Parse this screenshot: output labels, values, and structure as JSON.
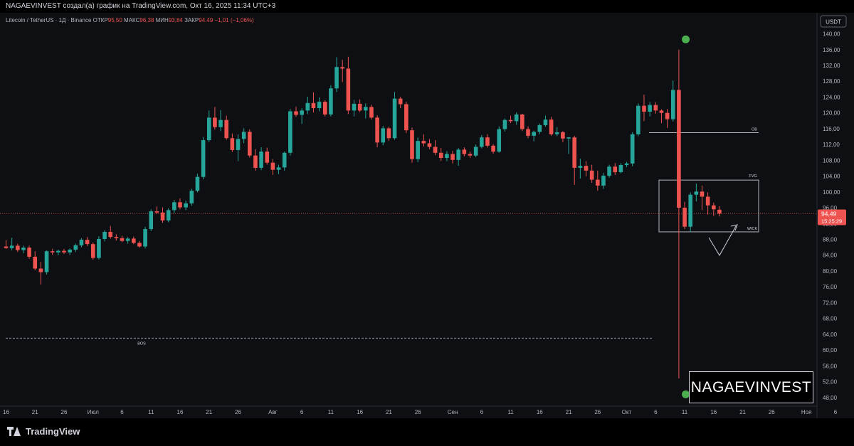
{
  "header": {
    "text": "NAGAEVINVEST создал(а) график на TradingView.com, Окт 16, 2025 11:34 UTC+3"
  },
  "brand": {
    "name": "TradingView"
  },
  "watermark": {
    "text": "NAGAEVINVEST"
  },
  "colors": {
    "up": "#26a69a",
    "down": "#ef5350",
    "background": "#0e0f13",
    "text": "#b2b5be",
    "accent_green": "#4caf50"
  },
  "chart_data": {
    "type": "candlestick",
    "legend": {
      "symbol": "Litecoin / TetherUS · 1Д · Binance",
      "open_label": "ОТКР",
      "open": "95,50",
      "high_label": "МАКС",
      "high": "96,38",
      "low_label": "МИН",
      "low": "93,84",
      "close_label": "ЗАКР",
      "close": "94.49",
      "change": "−1,01 (−1,06%)"
    },
    "currency": "USDT",
    "ylim": [
      45.8,
      142.8
    ],
    "y_ticks": [
      "48,00",
      "52,00",
      "56,00",
      "60,00",
      "64,00",
      "68,00",
      "72,00",
      "76,00",
      "80,00",
      "84,00",
      "88,00",
      "92,00",
      "96,00",
      "100,00",
      "104,00",
      "108,00",
      "112,00",
      "116,00",
      "120,00",
      "124,00",
      "128,00",
      "132,00",
      "136,00",
      "140,00"
    ],
    "y_tick_values": [
      48,
      52,
      56,
      60,
      64,
      68,
      72,
      76,
      80,
      84,
      88,
      92,
      96,
      100,
      104,
      108,
      112,
      116,
      120,
      124,
      128,
      132,
      136,
      140
    ],
    "x_ticks": [
      {
        "label": "16",
        "day": 0
      },
      {
        "label": "21",
        "day": 5
      },
      {
        "label": "26",
        "day": 10
      },
      {
        "label": "Июл",
        "day": 15
      },
      {
        "label": "6",
        "day": 20
      },
      {
        "label": "11",
        "day": 25
      },
      {
        "label": "16",
        "day": 30
      },
      {
        "label": "21",
        "day": 35
      },
      {
        "label": "26",
        "day": 40
      },
      {
        "label": "Авг",
        "day": 46
      },
      {
        "label": "6",
        "day": 51
      },
      {
        "label": "11",
        "day": 56
      },
      {
        "label": "16",
        "day": 61
      },
      {
        "label": "21",
        "day": 66
      },
      {
        "label": "26",
        "day": 71
      },
      {
        "label": "Сен",
        "day": 77
      },
      {
        "label": "6",
        "day": 82
      },
      {
        "label": "11",
        "day": 87
      },
      {
        "label": "16",
        "day": 92
      },
      {
        "label": "21",
        "day": 97
      },
      {
        "label": "26",
        "day": 102
      },
      {
        "label": "Окт",
        "day": 107
      },
      {
        "label": "6",
        "day": 112
      },
      {
        "label": "11",
        "day": 117
      },
      {
        "label": "16",
        "day": 122
      },
      {
        "label": "21",
        "day": 127
      },
      {
        "label": "26",
        "day": 132
      },
      {
        "label": "Ноя",
        "day": 138
      },
      {
        "label": "6",
        "day": 143
      }
    ],
    "candles": [
      [
        86.2,
        87.8,
        85.6,
        85.8
      ],
      [
        85.8,
        88.4,
        85.2,
        86.4
      ],
      [
        86.4,
        86.9,
        84.8,
        85.3
      ],
      [
        85.3,
        86.4,
        84.5,
        85.9
      ],
      [
        85.9,
        86.4,
        83.1,
        83.6
      ],
      [
        83.6,
        85.0,
        80.2,
        80.6
      ],
      [
        80.6,
        82.3,
        76.6,
        79.7
      ],
      [
        79.7,
        85.2,
        79.1,
        85.0
      ],
      [
        85.0,
        85.6,
        84.1,
        84.7
      ],
      [
        84.7,
        85.4,
        84.0,
        85.1
      ],
      [
        85.1,
        85.6,
        84.3,
        84.7
      ],
      [
        84.7,
        85.7,
        84.1,
        85.4
      ],
      [
        85.4,
        86.9,
        84.8,
        86.5
      ],
      [
        86.5,
        88.3,
        86.0,
        87.9
      ],
      [
        87.9,
        88.6,
        86.3,
        86.8
      ],
      [
        86.8,
        87.2,
        82.8,
        83.3
      ],
      [
        83.3,
        88.8,
        82.9,
        88.1
      ],
      [
        88.1,
        90.3,
        87.5,
        89.9
      ],
      [
        89.9,
        91.4,
        88.2,
        88.6
      ],
      [
        88.6,
        89.3,
        87.7,
        88.3
      ],
      [
        88.3,
        88.9,
        87.3,
        87.6
      ],
      [
        87.6,
        88.6,
        86.9,
        88.2
      ],
      [
        88.2,
        88.7,
        86.8,
        87.1
      ],
      [
        87.1,
        87.6,
        85.9,
        86.2
      ],
      [
        86.2,
        91.2,
        85.7,
        90.6
      ],
      [
        90.6,
        95.6,
        90.1,
        95.1
      ],
      [
        95.1,
        96.3,
        94.5,
        94.8
      ],
      [
        94.8,
        96.1,
        92.2,
        92.8
      ],
      [
        92.8,
        95.9,
        92.3,
        95.4
      ],
      [
        95.4,
        98.0,
        94.7,
        97.4
      ],
      [
        97.4,
        98.4,
        95.6,
        96.1
      ],
      [
        96.1,
        97.8,
        95.4,
        97.1
      ],
      [
        97.1,
        100.8,
        96.5,
        100.3
      ],
      [
        100.3,
        104.6,
        99.9,
        103.8
      ],
      [
        103.8,
        113.9,
        103.2,
        113.1
      ],
      [
        113.1,
        120.6,
        112.6,
        118.8
      ],
      [
        118.8,
        121.5,
        115.8,
        116.4
      ],
      [
        116.4,
        120.7,
        115.4,
        118.2
      ],
      [
        118.2,
        119.3,
        113.2,
        113.6
      ],
      [
        113.6,
        114.8,
        110.1,
        110.6
      ],
      [
        110.6,
        114.6,
        107.8,
        113.4
      ],
      [
        113.4,
        116.1,
        112.3,
        115.2
      ],
      [
        115.2,
        115.8,
        108.7,
        109.2
      ],
      [
        109.2,
        110.8,
        105.4,
        106.1
      ],
      [
        106.1,
        111.3,
        105.5,
        110.2
      ],
      [
        110.2,
        111.2,
        106.9,
        107.4
      ],
      [
        107.4,
        108.3,
        104.3,
        105.6
      ],
      [
        105.6,
        106.9,
        104.5,
        106.2
      ],
      [
        106.2,
        110.2,
        105.4,
        109.9
      ],
      [
        109.9,
        121.0,
        109.2,
        120.4
      ],
      [
        120.4,
        121.6,
        119.0,
        119.5
      ],
      [
        119.5,
        121.2,
        117.2,
        120.6
      ],
      [
        120.6,
        124.1,
        119.7,
        122.5
      ],
      [
        122.5,
        125.2,
        120.1,
        121.2
      ],
      [
        121.2,
        123.9,
        120.4,
        122.8
      ],
      [
        122.8,
        123.2,
        119.1,
        119.6
      ],
      [
        119.6,
        127.0,
        119.1,
        126.2
      ],
      [
        126.2,
        134.1,
        125.3,
        131.6
      ],
      [
        131.6,
        133.4,
        127.8,
        131.2
      ],
      [
        131.2,
        134.2,
        119.7,
        120.6
      ],
      [
        120.6,
        123.3,
        119.1,
        122.3
      ],
      [
        122.3,
        123.4,
        120.2,
        120.6
      ],
      [
        120.6,
        122.4,
        118.6,
        121.5
      ],
      [
        121.5,
        122.1,
        118.3,
        118.8
      ],
      [
        118.8,
        119.4,
        111.3,
        112.5
      ],
      [
        112.5,
        116.7,
        111.8,
        116.1
      ],
      [
        116.1,
        116.5,
        112.9,
        113.6
      ],
      [
        113.6,
        125.3,
        113.2,
        123.6
      ],
      [
        123.6,
        124.1,
        121.2,
        122.2
      ],
      [
        122.2,
        122.8,
        114.9,
        115.6
      ],
      [
        115.6,
        116.3,
        107.4,
        108.3
      ],
      [
        108.3,
        113.8,
        107.5,
        112.9
      ],
      [
        112.9,
        114.6,
        111.5,
        112.3
      ],
      [
        112.3,
        113.4,
        110.8,
        111.4
      ],
      [
        111.4,
        113.1,
        109.3,
        109.9
      ],
      [
        109.9,
        111.1,
        107.8,
        108.6
      ],
      [
        108.6,
        110.3,
        107.8,
        109.6
      ],
      [
        109.6,
        110.4,
        107.2,
        108.1
      ],
      [
        108.1,
        111.1,
        106.6,
        110.7
      ],
      [
        110.7,
        111.3,
        109.0,
        109.6
      ],
      [
        109.6,
        110.2,
        108.6,
        109.2
      ],
      [
        109.2,
        112.0,
        108.8,
        111.4
      ],
      [
        111.4,
        114.4,
        111.0,
        113.8
      ],
      [
        113.8,
        114.6,
        111.2,
        111.7
      ],
      [
        111.7,
        112.1,
        109.7,
        110.2
      ],
      [
        110.2,
        116.6,
        109.9,
        115.9
      ],
      [
        115.9,
        118.6,
        115.3,
        118.2
      ],
      [
        118.2,
        119.3,
        117.4,
        117.9
      ],
      [
        117.9,
        120.1,
        117.0,
        119.6
      ],
      [
        119.6,
        119.8,
        115.4,
        115.9
      ],
      [
        115.9,
        116.6,
        113.6,
        114.2
      ],
      [
        114.2,
        115.5,
        112.8,
        115.2
      ],
      [
        115.2,
        117.3,
        114.6,
        116.9
      ],
      [
        116.9,
        119.3,
        116.5,
        118.3
      ],
      [
        118.3,
        119.0,
        114.2,
        114.6
      ],
      [
        114.6,
        116.4,
        114.1,
        115.1
      ],
      [
        115.1,
        115.4,
        112.6,
        113.5
      ],
      [
        113.5,
        113.9,
        109.6,
        113.8
      ],
      [
        113.8,
        114.2,
        101.8,
        106.1
      ],
      [
        106.1,
        108.4,
        103.4,
        106.6
      ],
      [
        106.6,
        107.8,
        103.9,
        105.4
      ],
      [
        105.4,
        106.9,
        102.3,
        103.1
      ],
      [
        103.1,
        105.4,
        100.3,
        101.6
      ],
      [
        101.6,
        104.8,
        100.8,
        104.1
      ],
      [
        104.1,
        106.9,
        103.6,
        106.4
      ],
      [
        106.4,
        107.3,
        104.3,
        105.0
      ],
      [
        105.0,
        107.3,
        104.7,
        106.8
      ],
      [
        106.8,
        107.6,
        106.3,
        107.2
      ],
      [
        107.2,
        115.1,
        106.5,
        114.6
      ],
      [
        114.6,
        122.4,
        114.1,
        121.8
      ],
      [
        121.8,
        124.6,
        117.9,
        120.3
      ],
      [
        120.3,
        122.7,
        119.1,
        122.0
      ],
      [
        122.0,
        122.7,
        119.8,
        120.6
      ],
      [
        120.6,
        120.9,
        117.4,
        120.0
      ],
      [
        120.0,
        121.0,
        116.2,
        118.4
      ],
      [
        118.4,
        128.2,
        117.8,
        125.8
      ],
      [
        125.8,
        136.0,
        52.8,
        96.0
      ],
      [
        96.0,
        97.5,
        90.6,
        91.2
      ],
      [
        91.2,
        99.9,
        89.8,
        99.3
      ],
      [
        99.3,
        102.1,
        97.6,
        100.1
      ],
      [
        100.1,
        101.6,
        95.4,
        98.8
      ],
      [
        98.8,
        99.9,
        94.3,
        96.6
      ],
      [
        96.6,
        97.3,
        93.9,
        95.6
      ],
      [
        95.5,
        96.4,
        93.8,
        94.5
      ]
    ],
    "current_price": "94,49",
    "current_price_value": 94.49,
    "countdown": "15:25:29",
    "annotations": {
      "ob": {
        "label": "OB",
        "price": 115.0
      },
      "fvg": {
        "label": "FVG",
        "top": 103.0,
        "bottom": 89.9
      },
      "wick": {
        "label": "WICK",
        "price": 89.9
      },
      "bos": {
        "label": "BOS",
        "price": 63.0
      },
      "markers": [
        {
          "price": 138.6
        },
        {
          "price": 48.8
        }
      ]
    }
  }
}
